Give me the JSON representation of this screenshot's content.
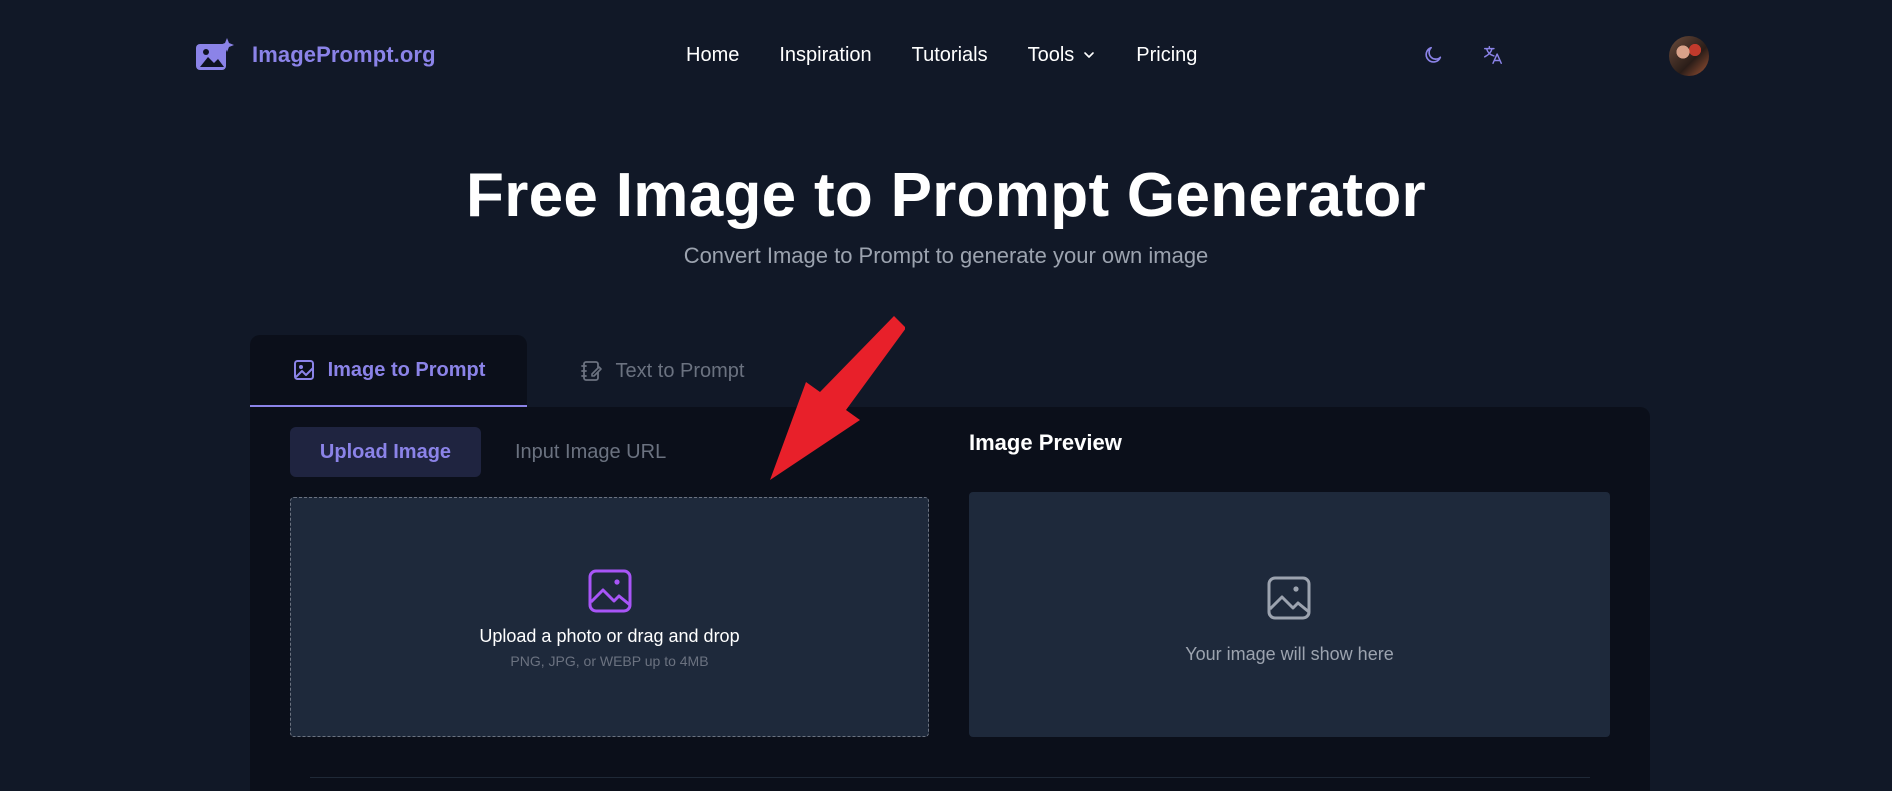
{
  "brand": {
    "name": "ImagePrompt.org",
    "logo_icon": "image-sparkle-icon",
    "accent": "#8b83e8"
  },
  "nav": {
    "items": [
      {
        "label": "Home"
      },
      {
        "label": "Inspiration"
      },
      {
        "label": "Tutorials"
      },
      {
        "label": "Tools"
      },
      {
        "label": "Pricing"
      }
    ]
  },
  "header_icons": {
    "theme": "moon-icon",
    "language": "translate-icon",
    "avatar": "user-avatar"
  },
  "hero": {
    "title": "Free Image to Prompt Generator",
    "subtitle": "Convert Image to Prompt to generate your own image"
  },
  "tabs": [
    {
      "label": "Image to Prompt",
      "icon": "image-icon",
      "active": true
    },
    {
      "label": "Text to Prompt",
      "icon": "notebook-pen-icon",
      "active": false
    }
  ],
  "upload": {
    "sub_tabs": [
      {
        "label": "Upload Image",
        "active": true
      },
      {
        "label": "Input Image URL",
        "active": false
      }
    ],
    "dropzone_title": "Upload a photo or drag and drop",
    "dropzone_hint": "PNG, JPG, or WEBP up to 4MB"
  },
  "preview": {
    "title": "Image Preview",
    "placeholder": "Your image will show here"
  },
  "colors": {
    "background": "#111827",
    "panel": "#0b0f1a",
    "box": "#1e293b",
    "annotation_arrow": "#e8202a"
  }
}
